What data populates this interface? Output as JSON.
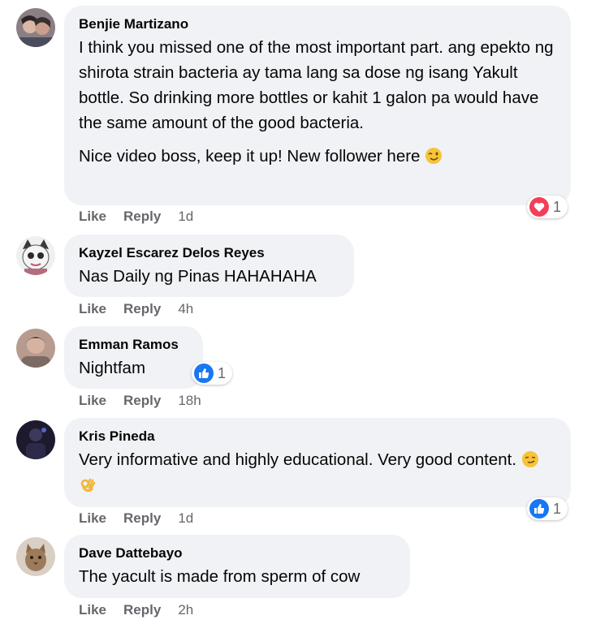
{
  "comments": [
    {
      "author": "Benjie Martizano",
      "paragraph1": "I think you missed one of the most important part. ang epekto ng shirota strain bacteria ay tama lang sa dose ng isang Yakult bottle. So drinking more bottles or kahit 1 galon pa would have the same amount of the good bacteria.",
      "paragraph2": "Nice video boss, keep it up! New follower here",
      "reaction_icon": "heart-icon",
      "reaction_count": "1",
      "like_label": "Like",
      "reply_label": "Reply",
      "time": "1d"
    },
    {
      "author": "Kayzel Escarez Delos Reyes",
      "text": "Nas Daily ng Pinas HAHAHAHA",
      "like_label": "Like",
      "reply_label": "Reply",
      "time": "4h"
    },
    {
      "author": "Emman Ramos",
      "text": "Nightfam",
      "reaction_icon": "thumbs-up-icon",
      "reaction_count": "1",
      "like_label": "Like",
      "reply_label": "Reply",
      "time": "18h"
    },
    {
      "author": "Kris Pineda",
      "text": "Very informative and highly educational. Very good content.",
      "reaction_icon": "thumbs-up-icon",
      "reaction_count": "1",
      "like_label": "Like",
      "reply_label": "Reply",
      "time": "1d"
    },
    {
      "author": "Dave Dattebayo",
      "text": "The yacult is made from sperm of cow",
      "like_label": "Like",
      "reply_label": "Reply",
      "time": "2h"
    }
  ],
  "colors": {
    "bubble": "#f0f2f5",
    "meta": "#65676b",
    "like_blue": "#1877f2",
    "love_red": "#f33e58"
  }
}
